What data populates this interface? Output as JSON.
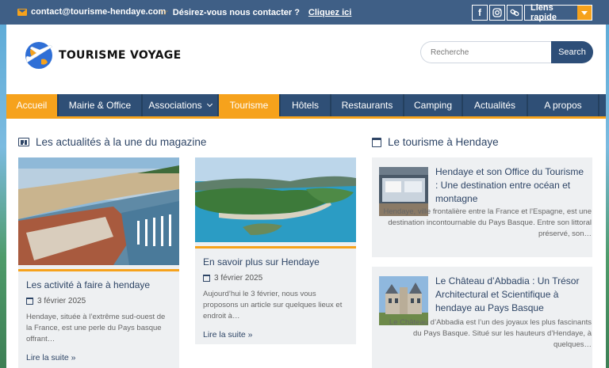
{
  "topbar": {
    "email": "contact@tourisme-hendaye.com",
    "contact_question": "Désirez-vous nous contacter ?",
    "contact_link": "Cliquez ici",
    "social_icons": [
      "facebook-icon",
      "instagram-icon",
      "link-icon"
    ],
    "quick_links": "Liens rapide"
  },
  "header": {
    "logo_text": "TOURISME VOYAGE",
    "search_placeholder": "Recherche",
    "search_button": "Search"
  },
  "nav": {
    "items": [
      {
        "label": "Accueil",
        "active": true
      },
      {
        "label": "Mairie & Office",
        "active": false
      },
      {
        "label": "Associations",
        "active": false,
        "dropdown": true
      },
      {
        "label": "Tourisme",
        "active": true
      },
      {
        "label": "Hôtels",
        "active": false
      },
      {
        "label": "Restaurants",
        "active": false
      },
      {
        "label": "Camping",
        "active": false
      },
      {
        "label": "Actualités",
        "active": false
      },
      {
        "label": "A propos",
        "active": false
      }
    ]
  },
  "main": {
    "section_title": "Les actualités à la une du magazine",
    "articles": [
      {
        "title": "Les activité à faire à hendaye",
        "date": "3 février 2025",
        "excerpt": "Hendaye, située à l’extrême sud-ouest de la France, est une perle du Pays basque offrant…",
        "read_more": "Lire la suite »"
      },
      {
        "title": "En savoir plus sur Hendaye",
        "date": "3 février 2025",
        "excerpt": "Aujourd’hui le 3 février, nous vous proposons un article sur quelques lieux et endroit à…",
        "read_more": "Lire la suite »"
      }
    ]
  },
  "sidebar": {
    "section_title": "Le tourisme à Hendaye",
    "posts": [
      {
        "title": "Hendaye et son Office du Tourisme : Une destination entre océan et montagne",
        "excerpt": "Hendaye, ville frontalière entre la France et l’Espagne, est une destination incontournable du Pays Basque. Entre son littoral préservé, son…"
      },
      {
        "title": "Le Château d’Abbadia : Un Trésor Architectural et Scientifique à hendaye au Pays Basque",
        "excerpt": "Le Château d’Abbadia est l’un des joyaux les plus fascinants du Pays Basque. Situé sur les hauteurs d’Hendaye, à quelques…"
      }
    ]
  },
  "colors": {
    "topbar": "#3f5f86",
    "nav": "#2f4f76",
    "accent": "#f6a21c",
    "text_heading": "#2e4566"
  }
}
